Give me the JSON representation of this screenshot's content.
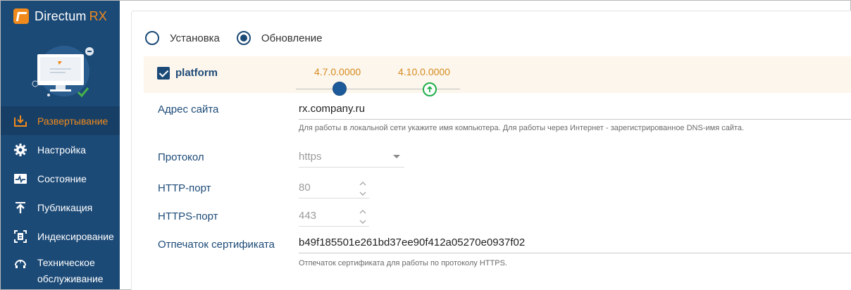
{
  "app": {
    "brand_name": "Directum",
    "brand_suffix": "RX"
  },
  "sidebar": {
    "items": [
      {
        "label": "Развертывание",
        "icon": "deploy-icon",
        "active": true
      },
      {
        "label": "Настройка",
        "icon": "gear-icon"
      },
      {
        "label": "Состояние",
        "icon": "pulse-icon"
      },
      {
        "label": "Публикация",
        "icon": "upload-icon"
      },
      {
        "label": "Индексирование",
        "icon": "index-icon"
      },
      {
        "label": "Техническое обслуживание",
        "icon": "maintenance-icon"
      }
    ]
  },
  "mode": {
    "options": [
      {
        "label": "Установка",
        "selected": false
      },
      {
        "label": "Обновление",
        "selected": true
      }
    ]
  },
  "package": {
    "name": "platform",
    "checked": true,
    "current_version": "4.7.0.0000",
    "new_version": "4.10.0.0000"
  },
  "form": {
    "site_address": {
      "label": "Адрес сайта",
      "value": "rx.company.ru",
      "hint": "Для работы в локальной сети укажите имя компьютера. Для работы через Интернет - зарегистрированное DNS-имя сайта."
    },
    "protocol": {
      "label": "Протокол",
      "value": "https"
    },
    "http_port": {
      "label": "HTTP-порт",
      "value": "80"
    },
    "https_port": {
      "label": "HTTPS-порт",
      "value": "443"
    },
    "cert_thumbprint": {
      "label": "Отпечаток сертификата",
      "value": "b49f185501e261bd37ee90f412a05270e0937f02",
      "hint": "Отпечаток сертификата для работы по протоколу HTTPS."
    }
  },
  "colors": {
    "sidebar": "#1c4a77",
    "accent": "#f08a1c",
    "version": "#d48a1e",
    "update": "#1fae4a"
  }
}
